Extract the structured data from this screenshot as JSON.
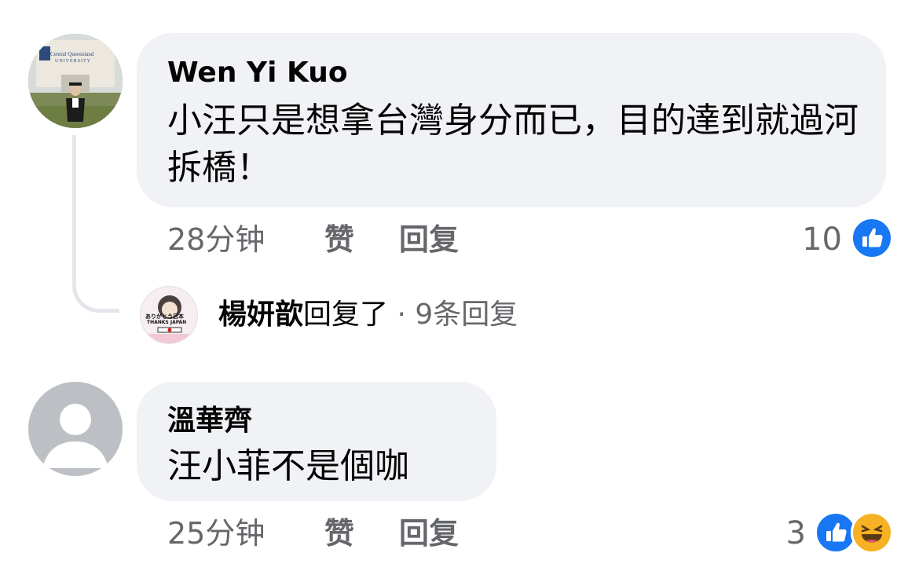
{
  "comments": [
    {
      "author": "Wen Yi Kuo",
      "text": "小汪只是想拿台灣身分而已，目的達到就過河拆橋！",
      "time": "28分钟",
      "like_label": "赞",
      "reply_label": "回复",
      "reaction_count": "10",
      "reactions": [
        "like-icon"
      ],
      "avatar_text": [
        "Central Queensland",
        "UNIVERSITY"
      ],
      "replies": {
        "replier": "楊妍歆",
        "verb": "回复了",
        "count_text": " · 9条回复",
        "avatar_text": [
          "ありがとう日本",
          "THANKS JAPAN"
        ]
      }
    },
    {
      "author": "溫華齊",
      "text": "汪小菲不是個咖",
      "time": "25分钟",
      "like_label": "赞",
      "reply_label": "回复",
      "reaction_count": "3",
      "reactions": [
        "like-icon",
        "haha-icon"
      ]
    }
  ],
  "colors": {
    "bubble": "#f0f2f5",
    "meta_text": "#65676b",
    "like_blue": "#1877f2",
    "haha_yellow": "#f7b125",
    "thread_line": "#e4e6eb"
  }
}
